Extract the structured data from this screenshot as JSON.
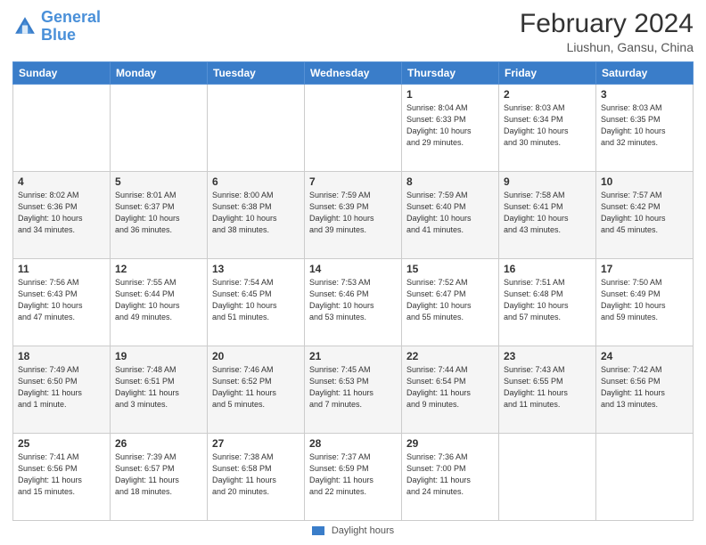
{
  "header": {
    "logo_line1": "General",
    "logo_line2": "Blue",
    "month_year": "February 2024",
    "location": "Liushun, Gansu, China"
  },
  "days_of_week": [
    "Sunday",
    "Monday",
    "Tuesday",
    "Wednesday",
    "Thursday",
    "Friday",
    "Saturday"
  ],
  "weeks": [
    [
      {
        "num": "",
        "info": ""
      },
      {
        "num": "",
        "info": ""
      },
      {
        "num": "",
        "info": ""
      },
      {
        "num": "",
        "info": ""
      },
      {
        "num": "1",
        "info": "Sunrise: 8:04 AM\nSunset: 6:33 PM\nDaylight: 10 hours\nand 29 minutes."
      },
      {
        "num": "2",
        "info": "Sunrise: 8:03 AM\nSunset: 6:34 PM\nDaylight: 10 hours\nand 30 minutes."
      },
      {
        "num": "3",
        "info": "Sunrise: 8:03 AM\nSunset: 6:35 PM\nDaylight: 10 hours\nand 32 minutes."
      }
    ],
    [
      {
        "num": "4",
        "info": "Sunrise: 8:02 AM\nSunset: 6:36 PM\nDaylight: 10 hours\nand 34 minutes."
      },
      {
        "num": "5",
        "info": "Sunrise: 8:01 AM\nSunset: 6:37 PM\nDaylight: 10 hours\nand 36 minutes."
      },
      {
        "num": "6",
        "info": "Sunrise: 8:00 AM\nSunset: 6:38 PM\nDaylight: 10 hours\nand 38 minutes."
      },
      {
        "num": "7",
        "info": "Sunrise: 7:59 AM\nSunset: 6:39 PM\nDaylight: 10 hours\nand 39 minutes."
      },
      {
        "num": "8",
        "info": "Sunrise: 7:59 AM\nSunset: 6:40 PM\nDaylight: 10 hours\nand 41 minutes."
      },
      {
        "num": "9",
        "info": "Sunrise: 7:58 AM\nSunset: 6:41 PM\nDaylight: 10 hours\nand 43 minutes."
      },
      {
        "num": "10",
        "info": "Sunrise: 7:57 AM\nSunset: 6:42 PM\nDaylight: 10 hours\nand 45 minutes."
      }
    ],
    [
      {
        "num": "11",
        "info": "Sunrise: 7:56 AM\nSunset: 6:43 PM\nDaylight: 10 hours\nand 47 minutes."
      },
      {
        "num": "12",
        "info": "Sunrise: 7:55 AM\nSunset: 6:44 PM\nDaylight: 10 hours\nand 49 minutes."
      },
      {
        "num": "13",
        "info": "Sunrise: 7:54 AM\nSunset: 6:45 PM\nDaylight: 10 hours\nand 51 minutes."
      },
      {
        "num": "14",
        "info": "Sunrise: 7:53 AM\nSunset: 6:46 PM\nDaylight: 10 hours\nand 53 minutes."
      },
      {
        "num": "15",
        "info": "Sunrise: 7:52 AM\nSunset: 6:47 PM\nDaylight: 10 hours\nand 55 minutes."
      },
      {
        "num": "16",
        "info": "Sunrise: 7:51 AM\nSunset: 6:48 PM\nDaylight: 10 hours\nand 57 minutes."
      },
      {
        "num": "17",
        "info": "Sunrise: 7:50 AM\nSunset: 6:49 PM\nDaylight: 10 hours\nand 59 minutes."
      }
    ],
    [
      {
        "num": "18",
        "info": "Sunrise: 7:49 AM\nSunset: 6:50 PM\nDaylight: 11 hours\nand 1 minute."
      },
      {
        "num": "19",
        "info": "Sunrise: 7:48 AM\nSunset: 6:51 PM\nDaylight: 11 hours\nand 3 minutes."
      },
      {
        "num": "20",
        "info": "Sunrise: 7:46 AM\nSunset: 6:52 PM\nDaylight: 11 hours\nand 5 minutes."
      },
      {
        "num": "21",
        "info": "Sunrise: 7:45 AM\nSunset: 6:53 PM\nDaylight: 11 hours\nand 7 minutes."
      },
      {
        "num": "22",
        "info": "Sunrise: 7:44 AM\nSunset: 6:54 PM\nDaylight: 11 hours\nand 9 minutes."
      },
      {
        "num": "23",
        "info": "Sunrise: 7:43 AM\nSunset: 6:55 PM\nDaylight: 11 hours\nand 11 minutes."
      },
      {
        "num": "24",
        "info": "Sunrise: 7:42 AM\nSunset: 6:56 PM\nDaylight: 11 hours\nand 13 minutes."
      }
    ],
    [
      {
        "num": "25",
        "info": "Sunrise: 7:41 AM\nSunset: 6:56 PM\nDaylight: 11 hours\nand 15 minutes."
      },
      {
        "num": "26",
        "info": "Sunrise: 7:39 AM\nSunset: 6:57 PM\nDaylight: 11 hours\nand 18 minutes."
      },
      {
        "num": "27",
        "info": "Sunrise: 7:38 AM\nSunset: 6:58 PM\nDaylight: 11 hours\nand 20 minutes."
      },
      {
        "num": "28",
        "info": "Sunrise: 7:37 AM\nSunset: 6:59 PM\nDaylight: 11 hours\nand 22 minutes."
      },
      {
        "num": "29",
        "info": "Sunrise: 7:36 AM\nSunset: 7:00 PM\nDaylight: 11 hours\nand 24 minutes."
      },
      {
        "num": "",
        "info": ""
      },
      {
        "num": "",
        "info": ""
      }
    ]
  ],
  "footer": {
    "legend_label": "Daylight hours"
  }
}
